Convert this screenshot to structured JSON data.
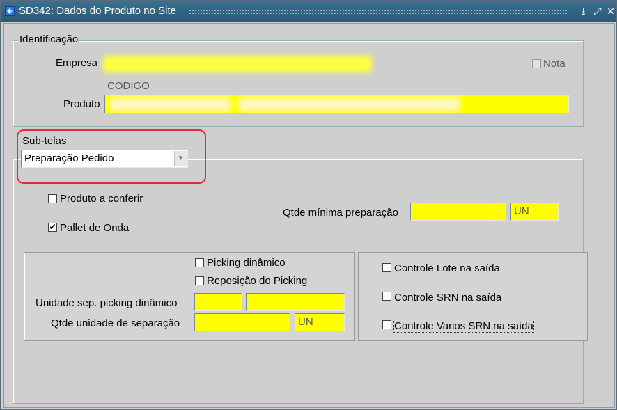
{
  "window": {
    "title": "SD342: Dados do Produto no Site"
  },
  "identificacao": {
    "legend": "Identificação",
    "empresa_label": "Empresa",
    "nota_label": "Nota",
    "codigo_label": "CODIGO",
    "produto_label": "Produto"
  },
  "subtelas": {
    "label": "Sub-telas",
    "selected": "Preparação Pedido"
  },
  "preparacao": {
    "produto_a_conferir": "Produto a conferir",
    "produto_a_conferir_checked": false,
    "pallet_de_onda": "Pallet de Onda",
    "pallet_de_onda_checked": true,
    "qtde_minima_label": "Qtde mínima preparação",
    "qtde_minima_value": "",
    "qtde_minima_unit": "UN"
  },
  "picking": {
    "picking_dinamico": "Picking dinâmico",
    "reposicao_picking": "Reposição do Picking",
    "unidade_sep_label": "Unidade sep. picking dinâmico",
    "qtde_unidade_label": "Qtde unidade de separação",
    "qtde_unidade_unit": "UN"
  },
  "controles": {
    "lote": "Controle Lote na saída",
    "srn": "Controle SRN na saída",
    "varios_srn": "Controle Varios SRN na saída"
  },
  "colors": {
    "required_field": "#ffff00",
    "highlight_box": "#e03030",
    "titlebar": "#2a5a78"
  }
}
